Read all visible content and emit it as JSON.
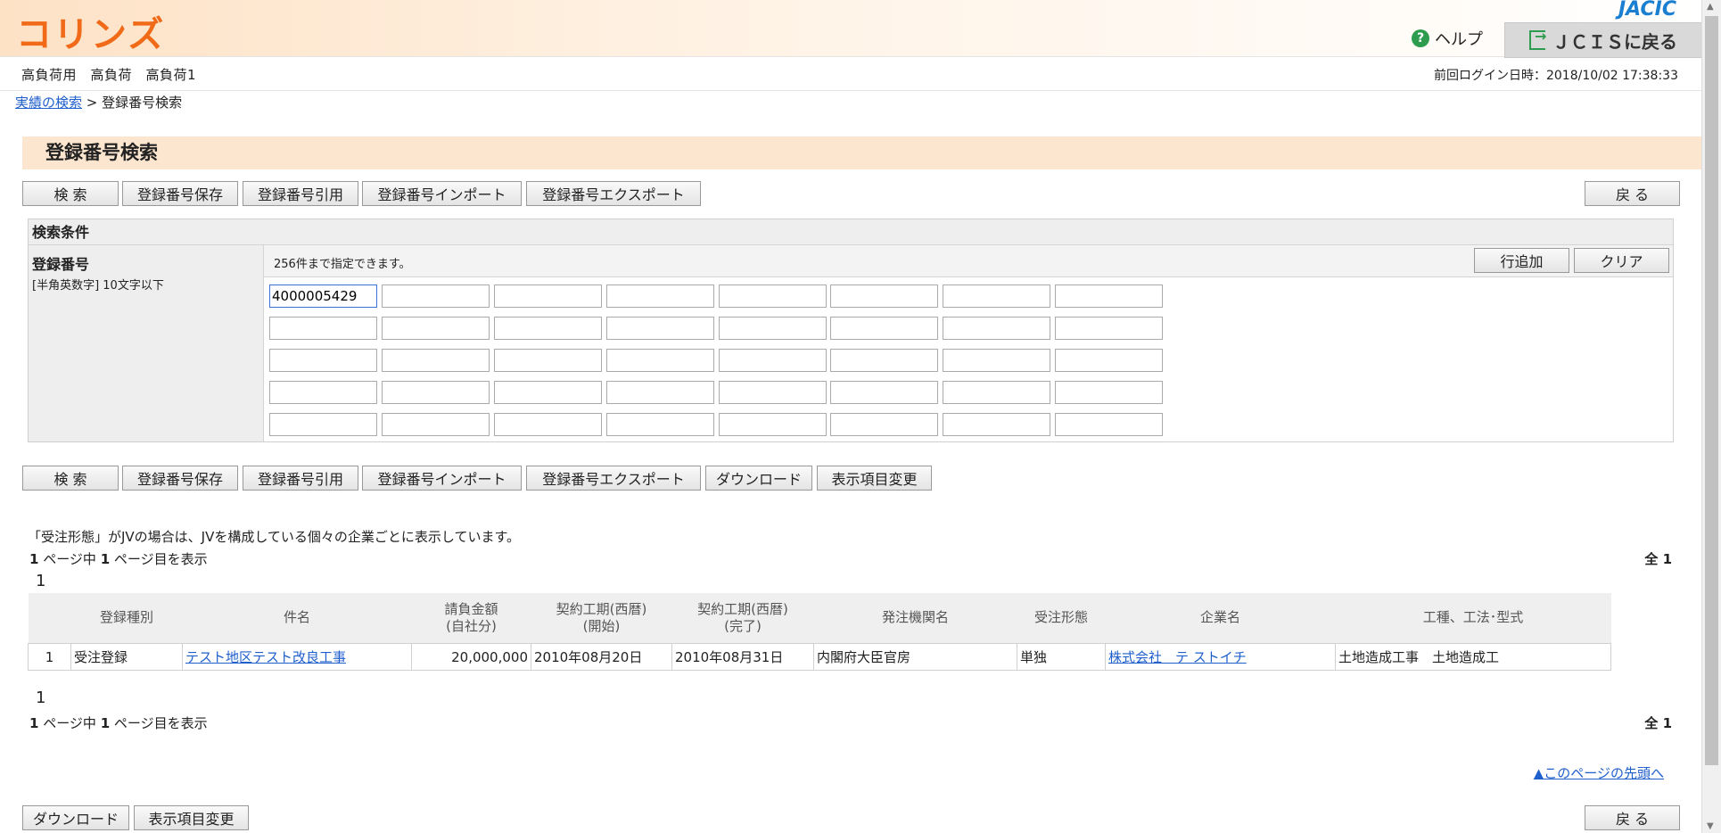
{
  "header": {
    "logo": "コリンズ",
    "brand": "JACIC",
    "help_label": "ヘルプ",
    "help_icon": "?",
    "jcis_label": "ＪＣＩＳに戻る"
  },
  "userbar": {
    "user_name": "高負荷用　高負荷　高負荷1",
    "last_login": "前回ログイン日時：2018/10/02 17:38:33"
  },
  "breadcrumb": {
    "parent": "実績の検索",
    "separator": ">",
    "current": "登録番号検索"
  },
  "page_title": "登録番号検索",
  "toolbar_top": {
    "search": "検 索",
    "save": "登録番号保存",
    "quote": "登録番号引用",
    "import": "登録番号インポート",
    "export": "登録番号エクスポート",
    "back": "戻 る"
  },
  "conditions": {
    "heading": "検索条件",
    "label": "登録番号",
    "sublabel": "[半角英数字] 10文字以下",
    "note": "256件まで指定できます。",
    "add_row": "行追加",
    "clear": "クリア",
    "first_value": "4000005429"
  },
  "toolbar_mid": {
    "search": "検 索",
    "save": "登録番号保存",
    "quote": "登録番号引用",
    "import": "登録番号インポート",
    "export": "登録番号エクスポート",
    "download": "ダウンロード",
    "display_change": "表示項目変更"
  },
  "results": {
    "notice": "「受注形態」がJVの場合は、JVを構成している個々の企業ごとに表示しています。",
    "page_current": "1",
    "page_total": "1",
    "page_text_a": "ページ中",
    "page_text_b": "ページ目を表示",
    "total_label": "全",
    "total_count": "1",
    "page_number": "1",
    "columns": {
      "type": "登録種別",
      "title": "件名",
      "amount": "請負金額",
      "amount_sub": "(自社分)",
      "start": "契約工期(西暦)",
      "start_sub": "(開始)",
      "end": "契約工期(西暦)",
      "end_sub": "(完了)",
      "orderer": "発注機関名",
      "form": "受注形態",
      "company": "企業名",
      "work": "工種、工法･型式"
    },
    "rows": [
      {
        "no": "1",
        "type": "受注登録",
        "title": "テスト地区テスト改良工事",
        "amount": "20,000,000",
        "start": "2010年08月20日",
        "end": "2010年08月31日",
        "orderer": "内閣府大臣官房",
        "form": "単独",
        "company": "株式会社　テ ストイチ",
        "work": "土地造成工事　土地造成工"
      }
    ]
  },
  "page_top_link": "▲このページの先頭へ",
  "toolbar_bottom": {
    "download": "ダウンロード",
    "display_change": "表示項目変更",
    "back": "戻 る"
  }
}
